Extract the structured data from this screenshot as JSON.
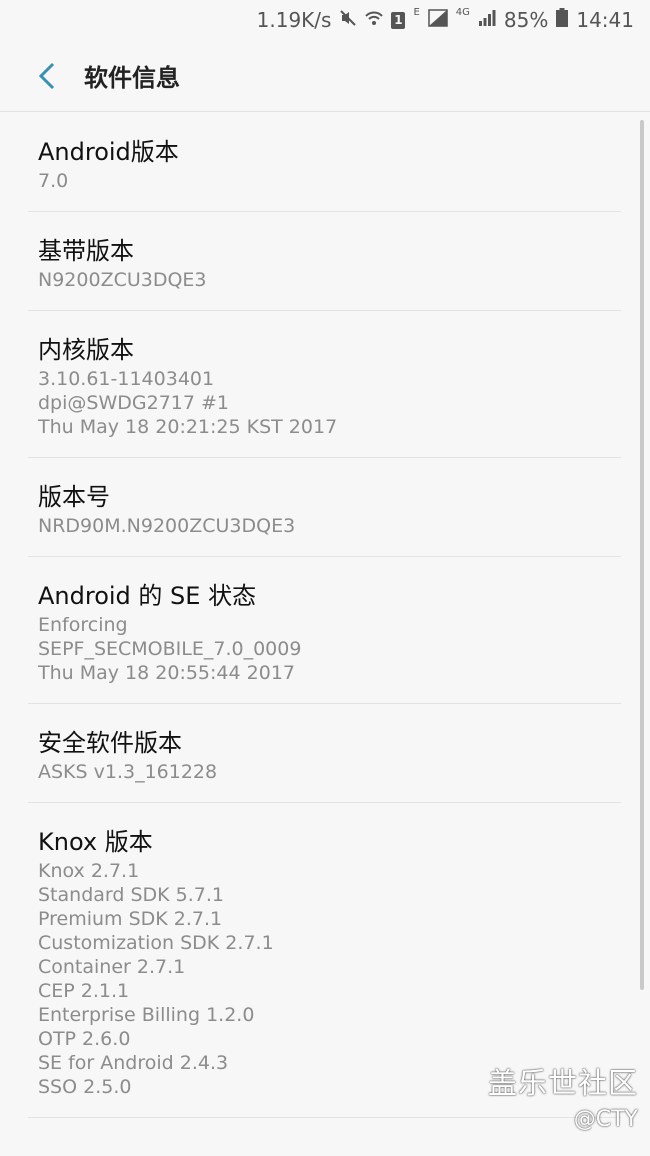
{
  "status_bar": {
    "speed": "1.19K/s",
    "e_label": "E",
    "net_label": "4G",
    "notif_count": "1",
    "battery": "85%",
    "time": "14:41",
    "icons": [
      "mute-icon",
      "wifi-icon",
      "notification-icon",
      "signal-icon",
      "battery-icon"
    ]
  },
  "header": {
    "title": "软件信息",
    "back_icon": "back-arrow-icon",
    "accent": "#3a8fb7"
  },
  "items": [
    {
      "title": "Android版本",
      "lines": [
        "7.0"
      ]
    },
    {
      "title": "基带版本",
      "lines": [
        "N9200ZCU3DQE3"
      ]
    },
    {
      "title": "内核版本",
      "lines": [
        "3.10.61-11403401",
        "dpi@SWDG2717 #1",
        "Thu May 18 20:21:25 KST 2017"
      ]
    },
    {
      "title": "版本号",
      "lines": [
        "NRD90M.N9200ZCU3DQE3"
      ]
    },
    {
      "title": "Android 的 SE 状态",
      "lines": [
        "Enforcing",
        "SEPF_SECMOBILE_7.0_0009",
        "Thu May 18 20:55:44 2017"
      ]
    },
    {
      "title": "安全软件版本",
      "lines": [
        "ASKS v1.3_161228"
      ]
    },
    {
      "title": "Knox 版本",
      "lines": [
        "Knox 2.7.1",
        "Standard SDK 5.7.1",
        "Premium SDK 2.7.1",
        "Customization SDK 2.7.1",
        "Container 2.7.1",
        "CEP 2.1.1",
        "Enterprise Billing 1.2.0",
        "OTP 2.6.0",
        "SE for Android 2.4.3",
        "SSO 2.5.0"
      ]
    }
  ],
  "watermark": {
    "title": "盖乐世社区",
    "handle": "@CTY"
  }
}
